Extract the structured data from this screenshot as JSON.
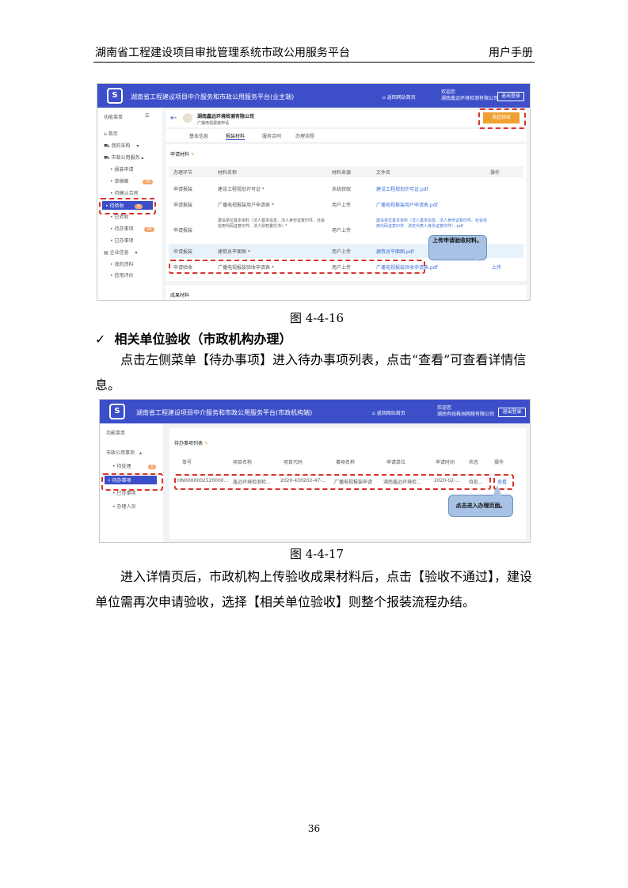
{
  "header": {
    "left": "湖南省工程建设项目审批管理系统市政公用服务平台",
    "right": "用户手册"
  },
  "fig1": {
    "topbar_title": "湖南省工程建设项目中介服务和市政公用服务平台(业主端)",
    "home_link": "返回网站首页",
    "welcome": "欢迎您",
    "company": "湖南鑫远环境检测有限公司",
    "logout": "退出登录",
    "sidebar": {
      "header": "功能菜单",
      "items": [
        "首页",
        "我的采购",
        "市政公用服务",
        "报装申请",
        "草稿箱",
        "待确认合同",
        "待验收",
        "已验收",
        "待办事项",
        "已办事项",
        "企业信息",
        "我的资料",
        "信用评价"
      ],
      "badges": [
        "20",
        "8",
        "24"
      ]
    },
    "company_name": "湖南鑫远环境检测有限公司",
    "company_sub": "广播电视报装申请",
    "apply_button": "发起验收",
    "tabs": [
      "基本信息",
      "报装材料",
      "服务合同",
      "办理流程"
    ],
    "section_title": "申请材料",
    "columns": [
      "办理环节",
      "材料名称",
      "材料来源",
      "文件名",
      "操作"
    ],
    "rows": [
      [
        "申请报装",
        "建设工程规划许可证 *",
        "系统获取",
        "建设工程规划许可证.pdf",
        ""
      ],
      [
        "申请报装",
        "广播电视报装用户申请表 *",
        "用户上传",
        "广播电视报装用户申请表.pdf",
        ""
      ],
      [
        "申请报装",
        "建设单位基本资料（法人基本信息、法人身份证复印件、社会信用代码证复印件、法人授权委托书）*",
        "用户上传",
        "建设单位基本资料（法人基本信息、法人身份证复印件、社会信用代码证复印件、法定代表人身份证复印件）.pdf",
        ""
      ],
      [
        "申请报装",
        "建筑总平面图 *",
        "用户上传",
        "建筑总平面图.pdf",
        ""
      ],
      [
        "申请验收",
        "广播电视报装验收申请表 *",
        "用户上传",
        "广播电视报装验收申请表.pdf",
        "上传"
      ]
    ],
    "callout": "上传申请验收材料。",
    "section2_title": "成果材料"
  },
  "caption1": "图 4-4-16",
  "section_heading": "相关单位验收（市政机构办理）",
  "para1": "点击左侧菜单【待办事项】进入待办事项列表，点击“查看”可查看详情信息。",
  "fig2": {
    "topbar_title": "湖南省工程建设项目中介服务和市政公用服务平台(市政机构端)",
    "home_link": "返回网站首页",
    "welcome": "欢迎您",
    "company": "湖南有线株洲网络有限公司",
    "logout": "退出登录",
    "sidebar": {
      "header": "功能菜单",
      "items": [
        "市政公用事项",
        "待处理",
        "待办事项",
        "已办事项",
        "办理人员"
      ],
      "badge": "0"
    },
    "list_title": "待办事项列表",
    "columns": [
      "单号",
      "项目名称",
      "项目代码",
      "事项名称",
      "申请单位",
      "申请时间",
      "状态",
      "操作"
    ],
    "row": [
      "HN0000002520000...",
      "鑫远环境检测检...",
      "2020-430202-47-...",
      "广播电视报装申请",
      "湖南鑫远环境检...",
      "2020-02-...",
      "待处...",
      "查看"
    ],
    "callout": "点击进入办理页面。"
  },
  "caption2": "图 4-4-17",
  "para2": "进入详情页后，市政机构上传验收成果材料后，点击【验收不通过】，建设单位需再次申请验收，选择【相关单位验收】则整个报装流程办结。",
  "page_number": "36"
}
